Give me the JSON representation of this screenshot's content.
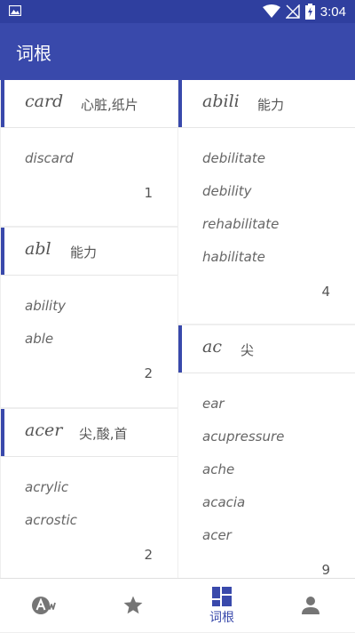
{
  "status_bar": {
    "time": "3:04"
  },
  "app_bar": {
    "title": "词根"
  },
  "roots": [
    {
      "word": "card",
      "meaning": "心脏,纸片",
      "examples": [
        "discard"
      ],
      "count": "1"
    },
    {
      "word": "abl",
      "meaning": "能力",
      "examples": [
        "ability",
        "able"
      ],
      "count": "2"
    },
    {
      "word": "acer",
      "meaning": "尖,酸,首",
      "examples": [
        "acrylic",
        "acrostic"
      ],
      "count": "2"
    },
    {
      "word": "abili",
      "meaning": "能力",
      "examples": [
        "debilitate",
        "debility",
        "rehabilitate",
        "habilitate"
      ],
      "count": "4"
    },
    {
      "word": "ac",
      "meaning": "尖",
      "examples": [
        "ear",
        "acupressure",
        "ache",
        "acacia",
        "acer"
      ],
      "count": "9"
    }
  ],
  "bottom_nav": {
    "items": [
      {
        "icon": "aw-icon",
        "label": ""
      },
      {
        "icon": "star-icon",
        "label": ""
      },
      {
        "icon": "grid-icon",
        "label": "词根",
        "active": true
      },
      {
        "icon": "person-icon",
        "label": ""
      }
    ]
  },
  "colors": {
    "primary": "#3949ab",
    "status_bar": "#2f3f9f",
    "active": "#3949ab",
    "inactive": "#757575"
  }
}
